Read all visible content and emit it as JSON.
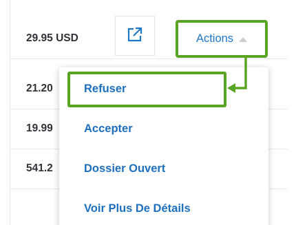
{
  "rows": [
    {
      "amount": "29.95 USD"
    },
    {
      "amount": "21.20"
    },
    {
      "amount": "19.99"
    },
    {
      "amount": "541.2"
    }
  ],
  "actions": {
    "label": "Actions"
  },
  "menu": {
    "items": [
      "Refuser",
      "Accepter",
      "Dossier Ouvert",
      "Voir Plus De Détails"
    ]
  },
  "colors": {
    "highlight": "#5aa424",
    "link": "#1e6fbe"
  },
  "icons": {
    "open_external": "external-link-icon",
    "actions_caret": "caret-up-icon",
    "callout_arrow": "arrow-left-icon"
  }
}
